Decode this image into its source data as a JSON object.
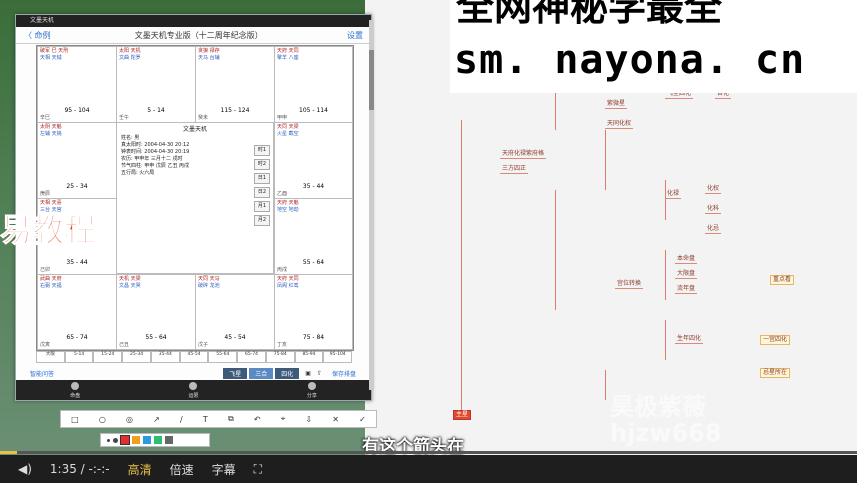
{
  "app": {
    "window_title": "文墨天机",
    "window_size_label": "1063 × 1164",
    "nav": {
      "back_label": "〈 命例",
      "title": "文墨天机专业版（十二周年纪念版）",
      "settings_label": "设置"
    },
    "chart": {
      "center_title": "文墨天机",
      "center_lines": [
        "姓名: 男",
        "真太阳时: 2004-04-30 20:12",
        "钟表时间: 2004-04-30 20:19",
        "农历: 甲申年 三月十二 戌时",
        "节气四柱: 甲申 戊辰 乙丑 丙戌",
        "五行局: 火六局"
      ],
      "center_buttons": [
        "时1",
        "时2",
        "日1",
        "日2",
        "月1",
        "月2"
      ],
      "palaces": [
        {
          "stars": "破军 巳 天刑",
          "stars2": "天相 天钺",
          "range": "95 - 104",
          "name": "",
          "gan": "辛巳"
        },
        {
          "stars": "太阳 天机",
          "stars2": "文曲 陀罗",
          "range": "5 - 14",
          "name": "",
          "gan": "壬午"
        },
        {
          "stars": "贪狼 禄存",
          "stars2": "天马 台辅",
          "range": "115 - 124",
          "name": "",
          "gan": "癸未"
        },
        {
          "stars": "天府 天同",
          "stars2": "擎羊 八座",
          "range": "105 - 114",
          "name": "",
          "gan": "甲申"
        },
        {
          "stars": "太阴 天魁",
          "stars2": "左辅 天姚",
          "range": "25 - 34",
          "name": "",
          "gan": "庚辰"
        },
        {
          "stars": "天同 天梁",
          "stars2": "火星 截空",
          "range": "35 - 44",
          "name": "",
          "gan": "乙酉"
        },
        {
          "stars": "天相 天喜",
          "stars2": "三台 天官",
          "range": "35 - 44",
          "name": "",
          "gan": "己卯"
        },
        {
          "stars": "天府 天魁",
          "stars2": "地空 地劫",
          "range": "55 - 64",
          "name": "",
          "gan": "丙戌"
        },
        {
          "stars": "武曲 天府",
          "stars2": "右弼 天福",
          "range": "65 - 74",
          "name": "",
          "gan": "戊寅"
        },
        {
          "stars": "天机 天梁",
          "stars2": "文昌 天哭",
          "range": "55 - 64",
          "name": "",
          "gan": "己丑"
        },
        {
          "stars": "天同 天马",
          "stars2": "破碎 龙池",
          "range": "45 - 54",
          "name": "",
          "gan": "戊子"
        },
        {
          "stars": "天府 天同",
          "stars2": "凤阁 红鸾",
          "range": "75 - 84",
          "name": "",
          "gan": "丁亥"
        }
      ],
      "timeline": [
        "大限",
        "5-14",
        "15-24",
        "25-34",
        "35-44",
        "45-54",
        "55-64",
        "65-74",
        "75-84",
        "85-94",
        "95-104"
      ]
    },
    "toolbar": {
      "left_label": "智能问答",
      "seg1": "飞星",
      "seg2": "三合",
      "seg3": "四化",
      "right_label": "保存排盘"
    },
    "bottom_bar": [
      "命盘",
      "运限",
      "分享"
    ]
  },
  "banner": {
    "line1": "全网神秘学最全",
    "line2": "sm. nayona. cn"
  },
  "overlay": {
    "left_watermark": "易教程",
    "right_watermark_1": "昊极紫薇",
    "right_watermark_2": "hjzw668",
    "subtitle": "有这个箭头在"
  },
  "mindmap": {
    "nodes": [
      "天府化禄紫府格",
      "三方四正",
      "紫微星",
      "天同化权",
      "飞星四化",
      "自化",
      "化禄",
      "化权",
      "化科",
      "化忌",
      "宫位转换",
      "本命盘",
      "大限盘",
      "流年盘",
      "重点看",
      "一宫四化",
      "生年四化",
      "忌星所在",
      "主星"
    ]
  },
  "player": {
    "time": "1:35 / -:-:-",
    "quality": "高清",
    "speed": "倍速",
    "subtitles": "字幕"
  }
}
